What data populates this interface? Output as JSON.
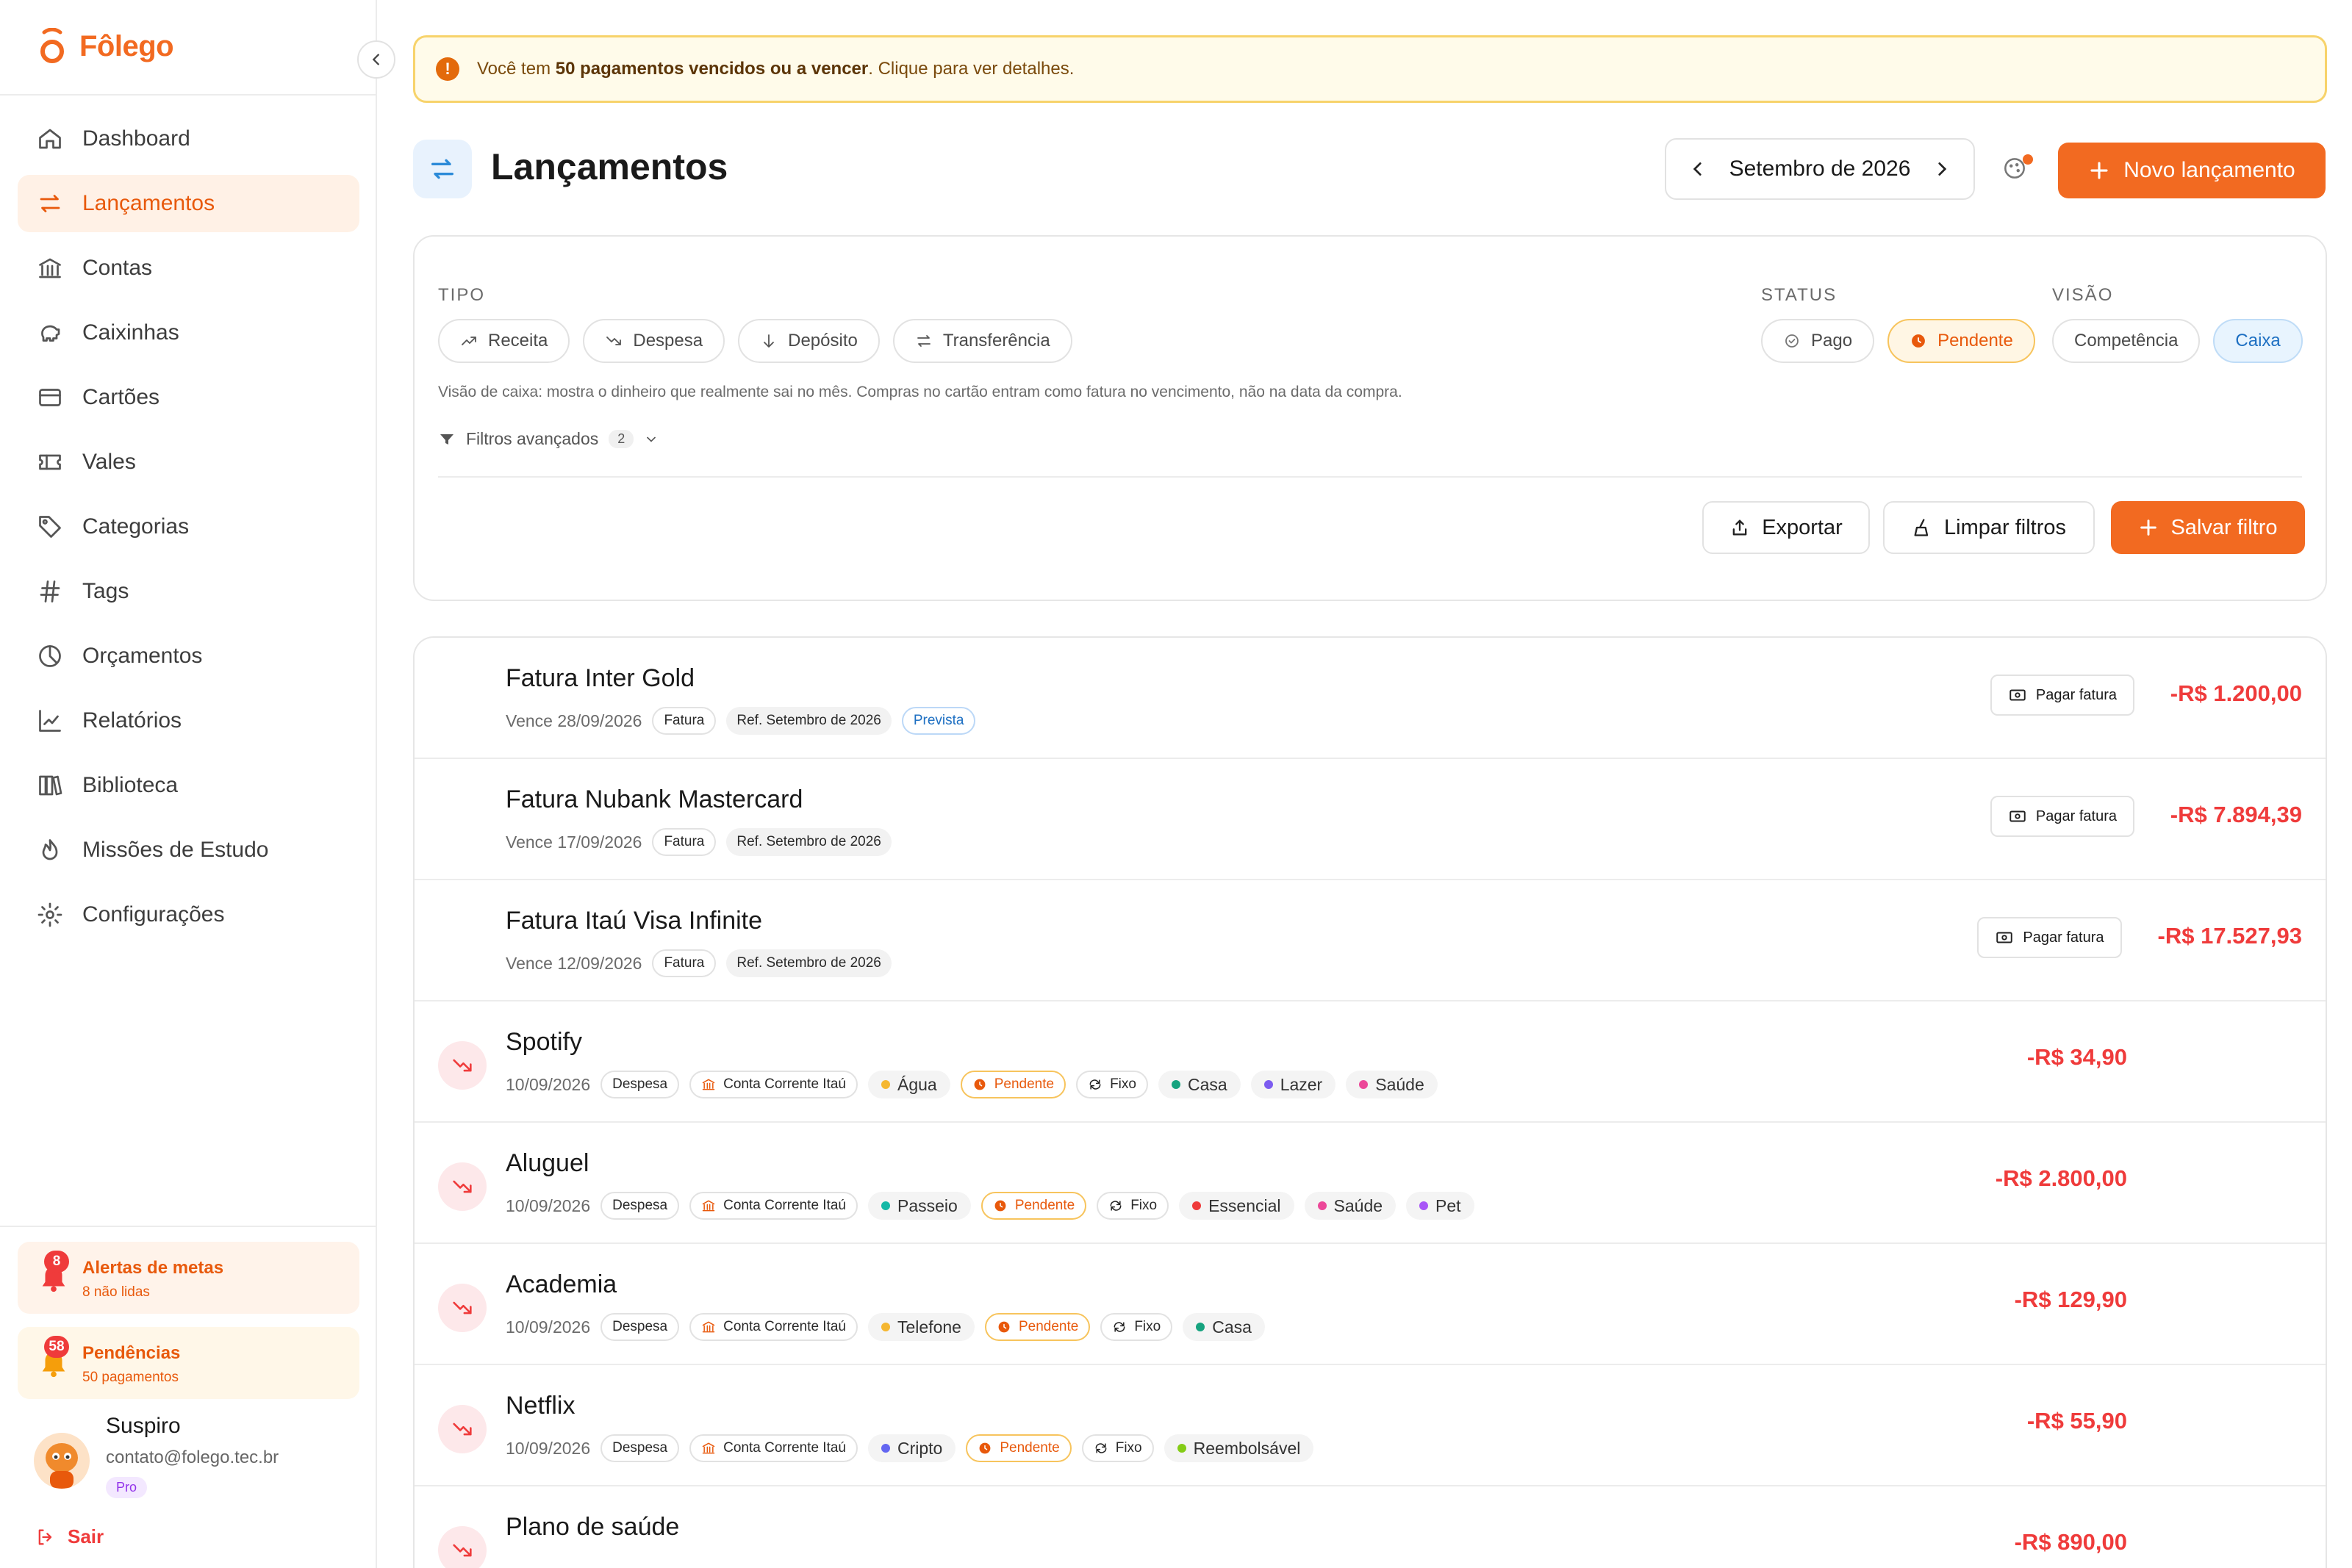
{
  "brand": {
    "name": "Fôlego",
    "color": "#f26a21"
  },
  "sidebar": {
    "items": [
      {
        "label": "Dashboard",
        "icon": "home-icon",
        "active": false
      },
      {
        "label": "Lançamentos",
        "icon": "transfer-arrows-icon",
        "active": true
      },
      {
        "label": "Contas",
        "icon": "bank-icon",
        "active": false
      },
      {
        "label": "Caixinhas",
        "icon": "piggy-bank-icon",
        "active": false
      },
      {
        "label": "Cartões",
        "icon": "credit-card-icon",
        "active": false
      },
      {
        "label": "Vales",
        "icon": "ticket-icon",
        "active": false
      },
      {
        "label": "Categorias",
        "icon": "tag-icon",
        "active": false
      },
      {
        "label": "Tags",
        "icon": "hash-icon",
        "active": false
      },
      {
        "label": "Orçamentos",
        "icon": "pie-chart-icon",
        "active": false
      },
      {
        "label": "Relatórios",
        "icon": "line-chart-icon",
        "active": false
      },
      {
        "label": "Biblioteca",
        "icon": "books-icon",
        "active": false
      },
      {
        "label": "Missões de Estudo",
        "icon": "flame-icon",
        "active": false
      },
      {
        "label": "Configurações",
        "icon": "gear-icon",
        "active": false
      }
    ],
    "goal_alerts": {
      "title": "Alertas de metas",
      "subtitle": "8 não lidas",
      "badge": "8"
    },
    "pending": {
      "title": "Pendências",
      "subtitle": "50 pagamentos",
      "badge": "58"
    },
    "user": {
      "name": "Suspiro",
      "email": "contato@folego.tec.br",
      "plan": "Pro"
    },
    "logout_label": "Sair"
  },
  "banner": {
    "prefix": "Você tem ",
    "highlight": "50 pagamentos vencidos ou a vencer",
    "suffix": ". Clique para ver detalhes."
  },
  "header": {
    "title": "Lançamentos",
    "month": "Setembro de 2026",
    "new_button": "Novo lançamento"
  },
  "filters": {
    "tipo_label": "TIPO",
    "tipo": [
      "Receita",
      "Despesa",
      "Depósito",
      "Transferência"
    ],
    "status_label": "STATUS",
    "status": [
      "Pago",
      "Pendente"
    ],
    "status_selected": "Pendente",
    "visao_label": "VISÃO",
    "visao": [
      "Competência",
      "Caixa"
    ],
    "visao_selected": "Caixa",
    "hint": "Visão de caixa: mostra o dinheiro que realmente sai no mês. Compras no cartão entram como fatura no vencimento, não na data da compra.",
    "advanced_label": "Filtros avançados",
    "advanced_count": "2",
    "export": "Exportar",
    "clear": "Limpar filtros",
    "save": "Salvar filtro"
  },
  "invoices": [
    {
      "title": "Fatura Inter Gold",
      "due": "Vence 28/09/2026",
      "kind": "Fatura",
      "ref": "Ref. Setembro de 2026",
      "badge": "Prevista",
      "action": "Pagar fatura",
      "amount": "-R$ 1.200,00"
    },
    {
      "title": "Fatura Nubank Mastercard",
      "due": "Vence 17/09/2026",
      "kind": "Fatura",
      "ref": "Ref. Setembro de 2026",
      "badge": "",
      "action": "Pagar fatura",
      "amount": "-R$ 7.894,39"
    },
    {
      "title": "Fatura Itaú Visa Infinite",
      "due": "Vence 12/09/2026",
      "kind": "Fatura",
      "ref": "Ref. Setembro de 2026",
      "badge": "",
      "action": "Pagar fatura",
      "amount": "-R$ 17.527,93"
    }
  ],
  "transactions": [
    {
      "title": "Spotify",
      "date": "10/09/2026",
      "kind": "Despesa",
      "account": "Conta Corrente Itaú",
      "category": {
        "label": "Água",
        "color": "#f5b731"
      },
      "status": "Pendente",
      "recurrence": "Fixo",
      "tags": [
        {
          "label": "Casa",
          "color": "#16a37f"
        },
        {
          "label": "Lazer",
          "color": "#7c5cf0"
        },
        {
          "label": "Saúde",
          "color": "#ec4899"
        }
      ],
      "amount": "-R$ 34,90"
    },
    {
      "title": "Aluguel",
      "date": "10/09/2026",
      "kind": "Despesa",
      "account": "Conta Corrente Itaú",
      "category": {
        "label": "Passeio",
        "color": "#14b8a6"
      },
      "status": "Pendente",
      "recurrence": "Fixo",
      "tags": [
        {
          "label": "Essencial",
          "color": "#ef3b3b"
        },
        {
          "label": "Saúde",
          "color": "#ec4899"
        },
        {
          "label": "Pet",
          "color": "#a855f7"
        }
      ],
      "amount": "-R$ 2.800,00"
    },
    {
      "title": "Academia",
      "date": "10/09/2026",
      "kind": "Despesa",
      "account": "Conta Corrente Itaú",
      "category": {
        "label": "Telefone",
        "color": "#f5b731"
      },
      "status": "Pendente",
      "recurrence": "Fixo",
      "tags": [
        {
          "label": "Casa",
          "color": "#16a37f"
        }
      ],
      "amount": "-R$ 129,90"
    },
    {
      "title": "Netflix",
      "date": "10/09/2026",
      "kind": "Despesa",
      "account": "Conta Corrente Itaú",
      "category": {
        "label": "Cripto",
        "color": "#6366f1"
      },
      "status": "Pendente",
      "recurrence": "Fixo",
      "tags": [
        {
          "label": "Reembolsável",
          "color": "#84cc16"
        }
      ],
      "amount": "-R$ 55,90"
    },
    {
      "title": "Plano de saúde",
      "date": "",
      "kind": "",
      "account": "",
      "category": {
        "label": "",
        "color": "#f5b731"
      },
      "status": "",
      "recurrence": "",
      "tags": [],
      "amount": "-R$ 890,00"
    }
  ],
  "colors": {
    "accent": "#f26a21",
    "negative": "#ef3b3b",
    "warning_bg": "#fffbea",
    "info": "#1d6fc2"
  }
}
